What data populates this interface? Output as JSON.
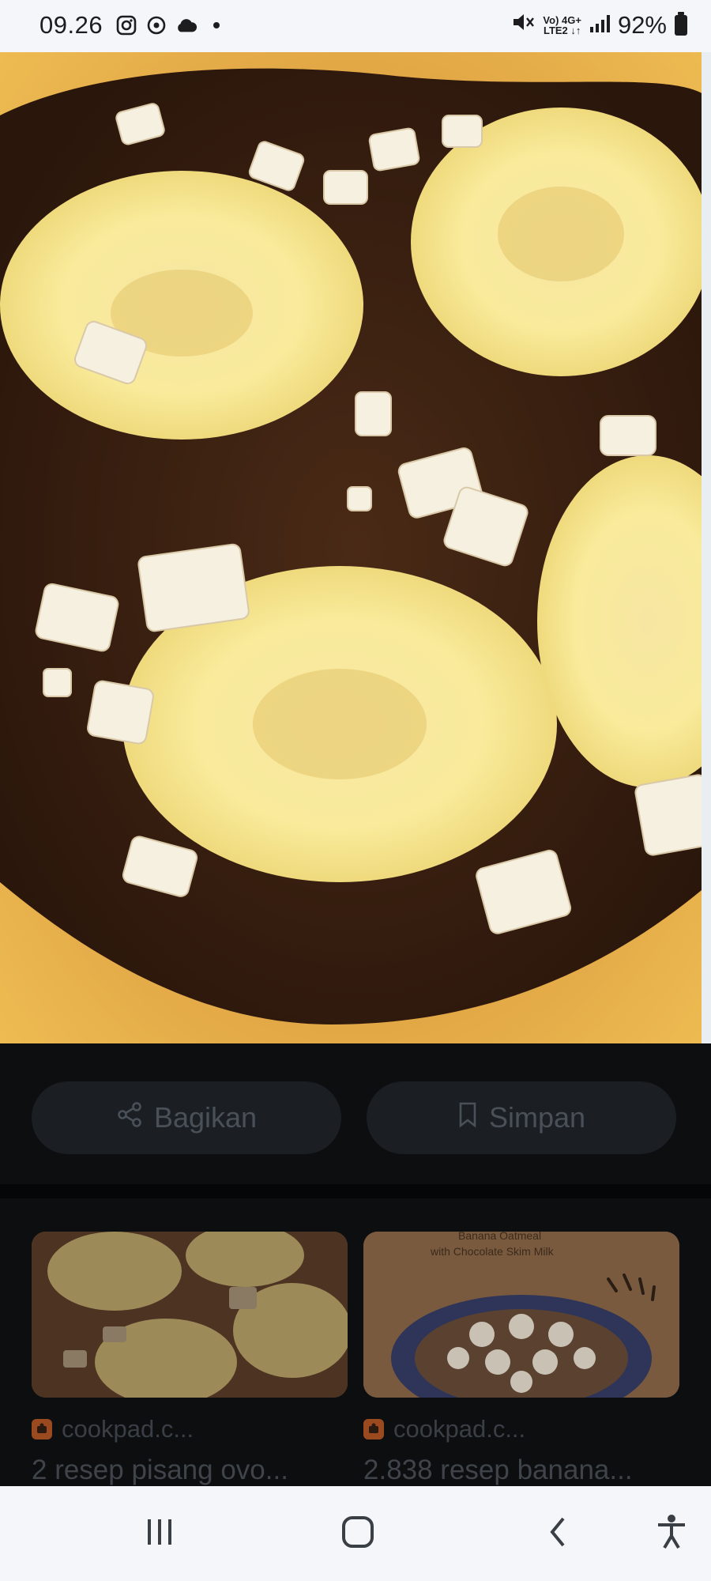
{
  "status_bar": {
    "time": "09.26",
    "network_top": "Vo) 4G+",
    "network_bottom": "LTE2 ↓↑",
    "battery": "92%",
    "icons": [
      "instagram-icon",
      "sync-icon",
      "cloud-icon",
      "dot-icon",
      "mute-icon",
      "signal-icon",
      "battery-icon"
    ]
  },
  "hero_image": {
    "description": "toast with chocolate spread, banana slices and peanuts"
  },
  "actions": {
    "share_label": "Bagikan",
    "save_label": "Simpan"
  },
  "related": [
    {
      "source": "cookpad.c...",
      "title": "2 resep pisang ovo...",
      "thumb_text": ""
    },
    {
      "source": "cookpad.c...",
      "title": "2.838 resep banana...",
      "thumb_text_1": "Banana Oatmeal",
      "thumb_text_2": "with Chocolate Skim Milk"
    }
  ],
  "nav": [
    "recents-icon",
    "home-icon",
    "back-icon",
    "accessibility-icon"
  ],
  "colors": {
    "dark_bg": "#0c0e10",
    "pill_bg": "#1b1f24",
    "muted_text": "#4a5058",
    "light_bar": "#f4f6fa"
  }
}
